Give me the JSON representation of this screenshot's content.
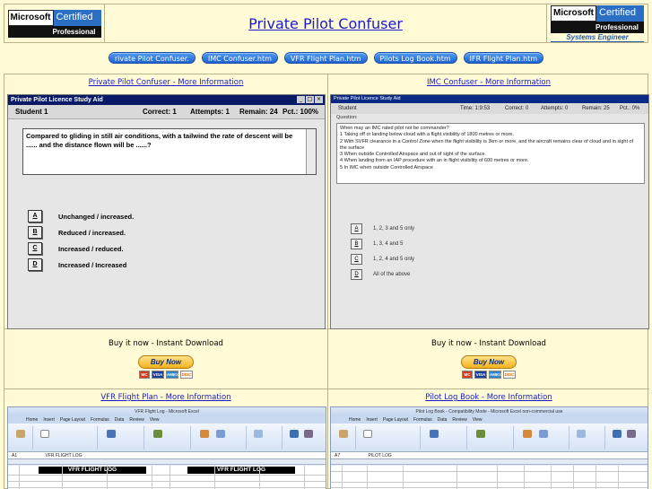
{
  "header": {
    "title": "Private Pilot Confuser",
    "left_logo": {
      "word": "Microsoft",
      "badge": "Certified",
      "sub": "Professional"
    },
    "right_logo": {
      "word": "Microsoft",
      "badge": "Certified",
      "sub": "Professional",
      "tagline": "Systems Engineer"
    }
  },
  "nav": [
    "rivate Pilot Confuser.",
    "IMC Confuser.htm",
    "VFR Flight Plan.htm",
    "Pilots Log Book.htm",
    "IFR Flight Plan.htm"
  ],
  "panels": {
    "ppc": {
      "link": "Private Pilot Confuser - More Information",
      "window_title": "Private Pilot Licence Study Aid",
      "controls": [
        "_",
        "□",
        "×"
      ],
      "student": "Student 1",
      "correct": "Correct: 1",
      "attempts": "Attempts: 1",
      "remain": "Remain: 24",
      "pct": "Pct.: 100%",
      "question": "Compared to gliding in still air conditions, with a tailwind the rate of descent will be ...... and the distance flown will be ......?",
      "answers": [
        {
          "key": "A",
          "text": "Unchanged / increased."
        },
        {
          "key": "B",
          "text": "Reduced / increased."
        },
        {
          "key": "C",
          "text": "Increased / reduced."
        },
        {
          "key": "D",
          "text": "Increased / Increased"
        }
      ]
    },
    "imc": {
      "link": "IMC Confuser - More Information",
      "window_title": "Private Pilot Licence Study Aid",
      "student": "Student",
      "time": "Time: 1:9:53",
      "correct": "Correct: 0",
      "attempts": "Attempts: 0",
      "remain": "Remain: 25",
      "pct": "Pct.: 0%",
      "question_label": "Question:",
      "question_lines": [
        "When may an IMC rated pilot not be commander?",
        "1 Taking off or landing below cloud with a flight visibility of 1800 metres or more.",
        "2 With SVFR clearance in a Control Zone when the flight visibility is 3km or more, and the aircraft remains clear of cloud and in sight of the surface",
        "3 When outside Controlled Airspace and out of sight of the surface.",
        "4 When landing from an IAP procedure with an in flight visibility of 600 metres or more.",
        "5 In IMC when outside Controlled Airspace"
      ],
      "answers": [
        {
          "key": "A",
          "text": "1, 2, 3 and 5 only"
        },
        {
          "key": "B",
          "text": "1, 3, 4 and 5"
        },
        {
          "key": "C",
          "text": "1, 2, 4 and 5 only"
        },
        {
          "key": "D",
          "text": "All of the above"
        }
      ]
    },
    "buy_left": {
      "text": "Buy it now - Instant Download",
      "button": "Buy Now"
    },
    "buy_right": {
      "text": "Buy it now - Instant Download",
      "button": "Buy Now"
    },
    "cards": [
      "MC",
      "VISA",
      "AMEX",
      "DISC"
    ],
    "vfr": {
      "link": "VFR Flight Plan - More Information",
      "window_title": "VFR Flight Log - Microsoft Excel",
      "tabs": [
        "Home",
        "Insert",
        "Page Layout",
        "Formulas",
        "Data",
        "Review",
        "View"
      ],
      "cell_ref": "A1",
      "formula": "VFR FLIGHT LOG",
      "banner_left": "VFR FLIGHT LOG",
      "banner_right": "VFR FLIGHT LOG"
    },
    "plb": {
      "link": "Pilot Log Book - More Information",
      "window_title": "Pilot Log Book - Compatibility Mode - Microsoft Excel non-commercial use",
      "tabs": [
        "Home",
        "Insert",
        "Page Layout",
        "Formulas",
        "Data",
        "Review",
        "View"
      ],
      "cell_ref": "A7",
      "formula": "PILOT LOG"
    }
  },
  "colors": {
    "background": "#fffbd6",
    "link": "#1a1acc",
    "nav_button": "#2f7be0",
    "window_title": "#081a66"
  }
}
